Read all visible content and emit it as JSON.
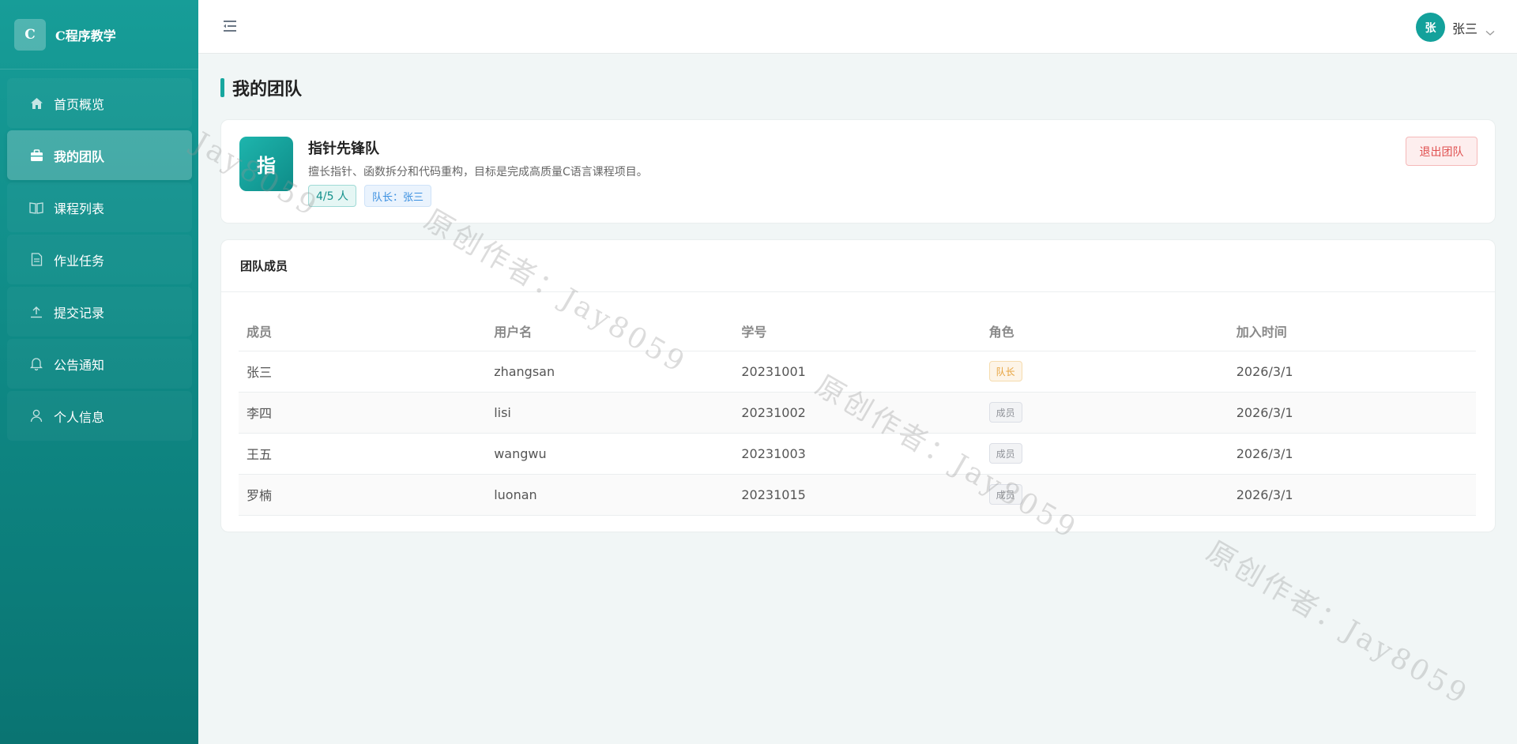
{
  "brand": {
    "logo_letter": "C",
    "title": "C程序教学"
  },
  "sidebar": {
    "items": [
      {
        "label": "首页概览",
        "icon": "home-icon",
        "active": false
      },
      {
        "label": "我的团队",
        "icon": "briefcase-icon",
        "active": true
      },
      {
        "label": "课程列表",
        "icon": "book-icon",
        "active": false
      },
      {
        "label": "作业任务",
        "icon": "document-icon",
        "active": false
      },
      {
        "label": "提交记录",
        "icon": "upload-icon",
        "active": false
      },
      {
        "label": "公告通知",
        "icon": "bell-icon",
        "active": false
      },
      {
        "label": "个人信息",
        "icon": "user-icon",
        "active": false
      }
    ]
  },
  "header": {
    "menu_icon": "menu-fold-icon",
    "user": {
      "avatar_char": "张",
      "name": "张三"
    }
  },
  "page": {
    "title": "我的团队"
  },
  "team": {
    "logo_char": "指",
    "name": "指针先锋队",
    "description": "擅长指针、函数拆分和代码重构，目标是完成高质量C语言课程项目。",
    "count_tag": "4/5 人",
    "leader_tag": "队长：张三",
    "quit_button": "退出团队"
  },
  "members": {
    "section_title": "团队成员",
    "columns": [
      "成员",
      "用户名",
      "学号",
      "角色",
      "加入时间"
    ],
    "rows": [
      {
        "name": "张三",
        "username": "zhangsan",
        "student_id": "20231001",
        "role": "队长",
        "joined": "2026/3/1"
      },
      {
        "name": "李四",
        "username": "lisi",
        "student_id": "20231002",
        "role": "成员",
        "joined": "2026/3/1"
      },
      {
        "name": "王五",
        "username": "wangwu",
        "student_id": "20231003",
        "role": "成员",
        "joined": "2026/3/1"
      },
      {
        "name": "罗楠",
        "username": "luonan",
        "student_id": "20231015",
        "role": "成员",
        "joined": "2026/3/1"
      }
    ]
  },
  "watermark": {
    "text": "原创作者：Jay8059",
    "short": "Jay8059"
  },
  "colors": {
    "primary": "#13a19b",
    "danger": "#e04f4f",
    "warning": "#e6a23c",
    "info": "#909399"
  }
}
